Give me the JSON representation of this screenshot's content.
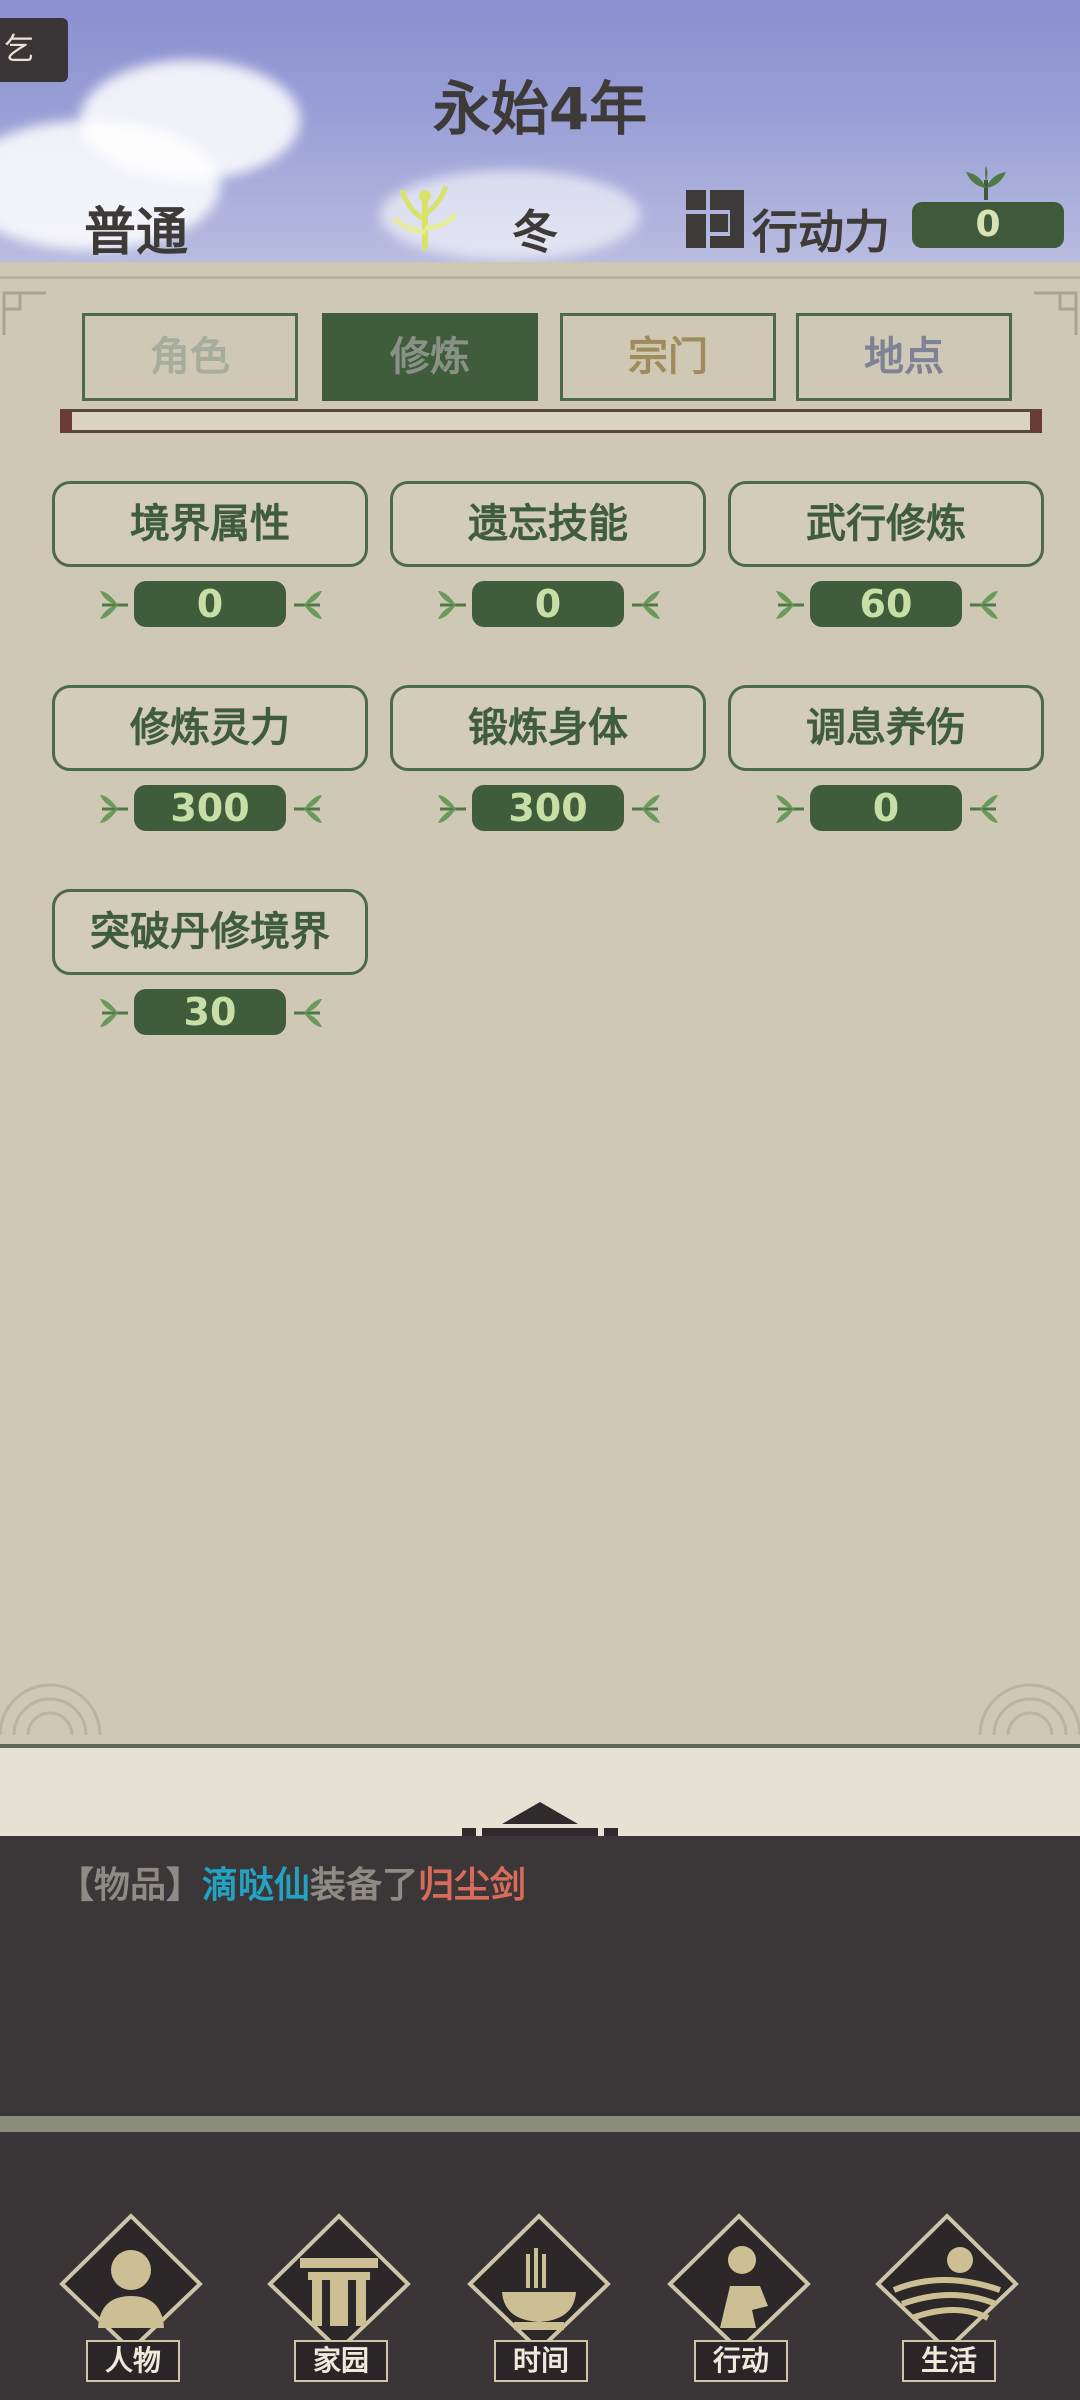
{
  "header": {
    "corner_chip": "乞",
    "year_title": "永始4年",
    "difficulty": "普通",
    "season": "冬",
    "action_points_label": "行动力",
    "action_points_value": "0"
  },
  "tabs": [
    {
      "label": "角色",
      "color": "#a7ad9c",
      "active": false
    },
    {
      "label": "修炼",
      "color": "#8a9287",
      "active": true
    },
    {
      "label": "宗门",
      "color": "#a08c5a",
      "active": false
    },
    {
      "label": "地点",
      "color": "#7f8196",
      "active": false
    }
  ],
  "skills": [
    {
      "name": "境界属性",
      "value": "0"
    },
    {
      "name": "遗忘技能",
      "value": "0"
    },
    {
      "name": "武行修炼",
      "value": "60"
    },
    {
      "name": "修炼灵力",
      "value": "300"
    },
    {
      "name": "锻炼身体",
      "value": "300"
    },
    {
      "name": "调息养伤",
      "value": "0"
    },
    {
      "name": "突破丹修境界",
      "value": "30"
    }
  ],
  "log": {
    "category": "【物品】",
    "name": "滴哒仙",
    "verb": "装备了",
    "item": "归尘剑"
  },
  "nav": [
    {
      "label": "人物",
      "icon": "person-icon"
    },
    {
      "label": "家园",
      "icon": "home-gate-icon"
    },
    {
      "label": "时间",
      "icon": "incense-icon"
    },
    {
      "label": "行动",
      "icon": "action-icon"
    },
    {
      "label": "生活",
      "icon": "landscape-icon"
    }
  ]
}
